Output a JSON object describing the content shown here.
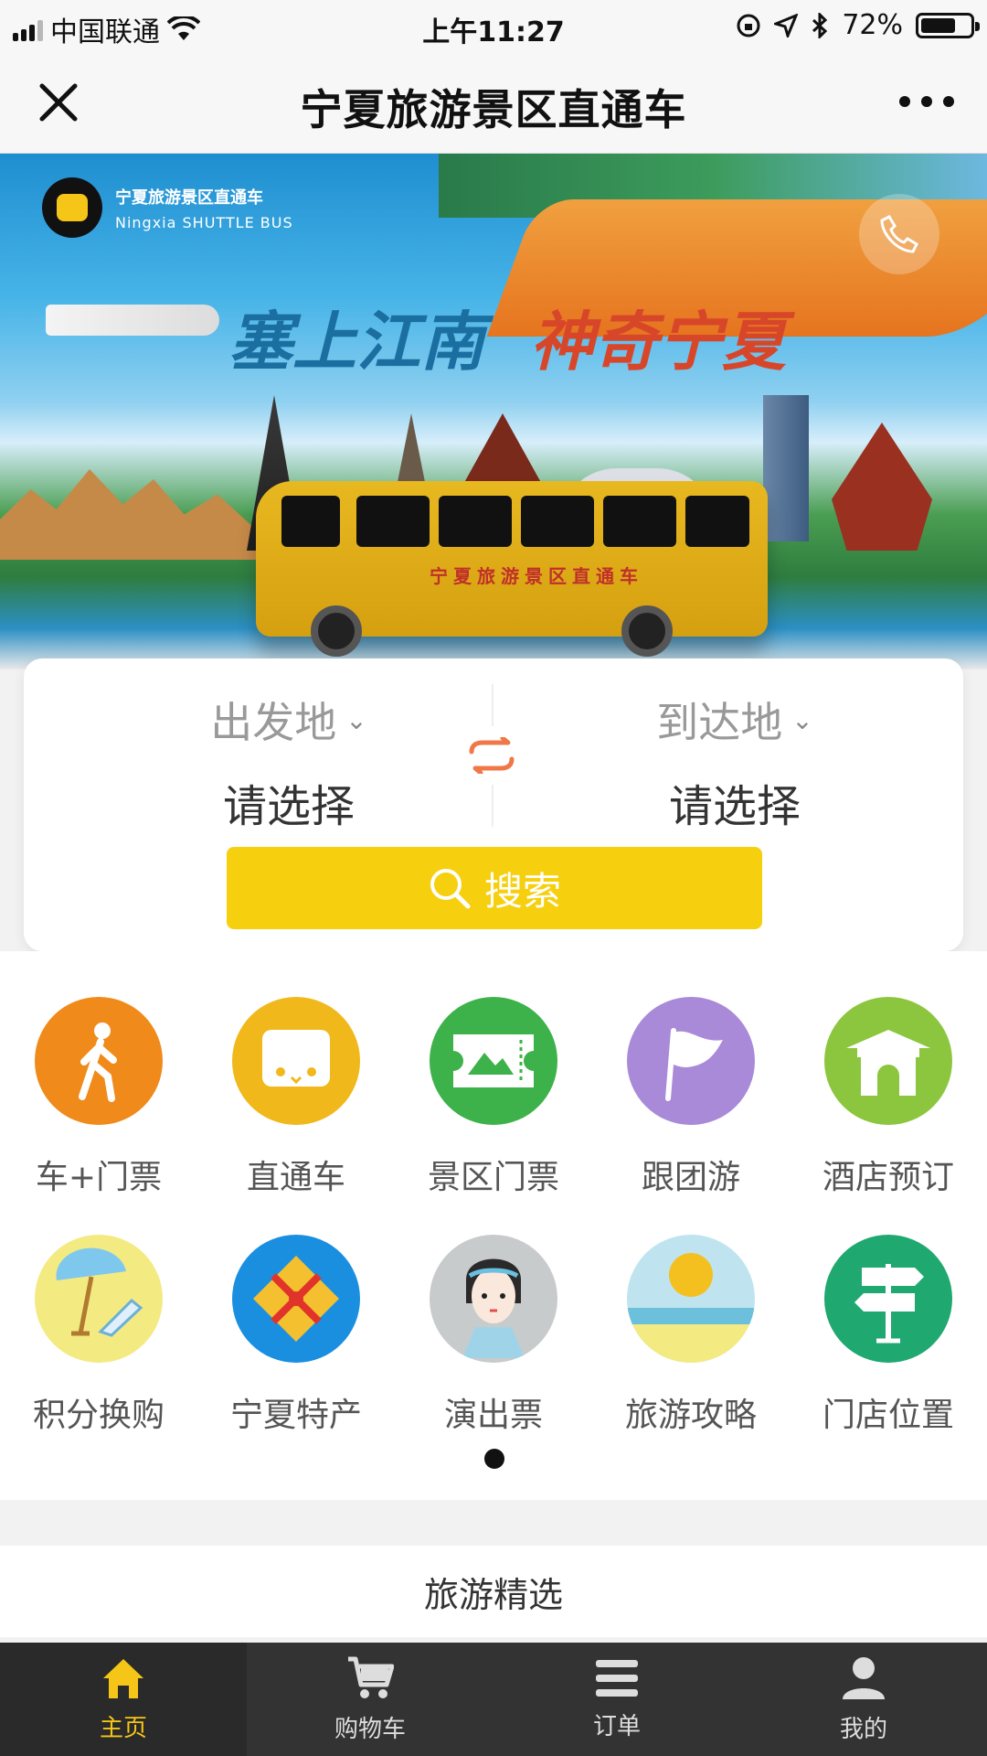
{
  "status_bar": {
    "carrier": "中国联通",
    "time": "上午11:27",
    "battery": "72%",
    "battery_level": 0.72
  },
  "nav": {
    "title": "宁夏旅游景区直通车",
    "close_icon": "close-icon",
    "more_icon": "more-icon"
  },
  "banner": {
    "logo_cn": "宁夏旅游景区直通车",
    "logo_en": "Ningxia SHUTTLE BUS",
    "slogan_a": "塞上江南",
    "slogan_b": "神奇宁夏",
    "bus_text": "宁夏旅游景区直通车"
  },
  "search": {
    "from_label": "出发地",
    "from_value": "请选择",
    "to_label": "到达地",
    "to_value": "请选择",
    "button_label": "搜索"
  },
  "grid": [
    {
      "label": "车+门票",
      "icon": "walking-person-icon",
      "color": "#f08a1a"
    },
    {
      "label": "直通车",
      "icon": "bus-face-icon",
      "color": "#f0b81a"
    },
    {
      "label": "景区门票",
      "icon": "ticket-icon",
      "color": "#3db24a"
    },
    {
      "label": "跟团游",
      "icon": "flag-icon",
      "color": "#a98ad8"
    },
    {
      "label": "酒店预订",
      "icon": "gate-icon",
      "color": "#8cc63f"
    },
    {
      "label": "积分换购",
      "icon": "beach-umbrella-icon",
      "color": "#f4ea82"
    },
    {
      "label": "宁夏特产",
      "icon": "gift-box-icon",
      "color": "#1a8fe0"
    },
    {
      "label": "演出票",
      "icon": "opera-performer-icon",
      "color": "#c8cbcc"
    },
    {
      "label": "旅游攻略",
      "icon": "sun-horizon-icon",
      "color": "#bfe4f0"
    },
    {
      "label": "门店位置",
      "icon": "signpost-icon",
      "color": "#1fa870"
    }
  ],
  "section": {
    "title": "旅游精选"
  },
  "tabs": [
    {
      "label": "主页",
      "icon": "home-icon",
      "active": true
    },
    {
      "label": "购物车",
      "icon": "cart-icon",
      "active": false
    },
    {
      "label": "订单",
      "icon": "list-icon",
      "active": false
    },
    {
      "label": "我的",
      "icon": "user-icon",
      "active": false
    }
  ],
  "colors": {
    "accent": "#f6cf0e",
    "tab_active": "#f5c518",
    "tab_bar_bg": "#333333"
  }
}
